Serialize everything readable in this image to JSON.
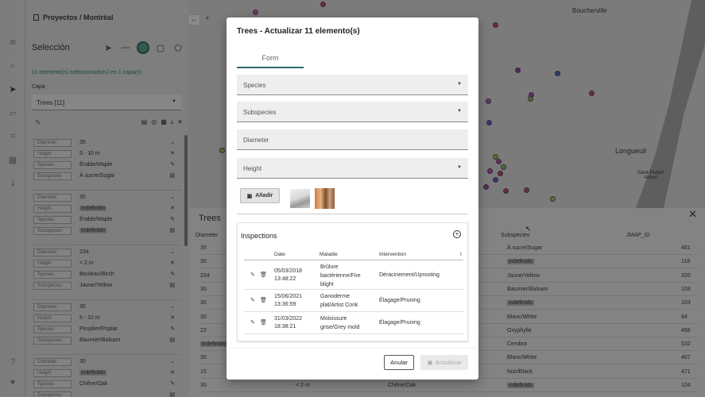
{
  "colors": {
    "accent": "#2c6b63",
    "highlight": "#315a55",
    "chip": "#686868"
  },
  "header": {
    "project": "Proyectos / Montréal"
  },
  "leftbar": {
    "icons": [
      "layers-icon",
      "search-icon",
      "cursor-icon",
      "ruler-icon",
      "crop-icon",
      "map-icon",
      "download-icon",
      "help-icon",
      "user-icon"
    ]
  },
  "selection": {
    "title": "Selección",
    "count_text": "11 elemento(s) seleccionado(s) en 1 capa(s)",
    "capa_label": "Capa",
    "capa_value": "Trees [11]",
    "records": [
      {
        "rows": [
          {
            "k": "Diameter",
            "v": "35",
            "chip": false
          },
          {
            "k": "Height",
            "v": "5 - 10 m",
            "chip": false
          },
          {
            "k": "Species",
            "v": "Érable/Maple",
            "chip": false
          },
          {
            "k": "Subspecies",
            "v": "À sucre/Sugar",
            "chip": false
          }
        ]
      },
      {
        "rows": [
          {
            "k": "Diameter",
            "v": "30",
            "chip": false
          },
          {
            "k": "Height",
            "v": "indefinido",
            "chip": true
          },
          {
            "k": "Species",
            "v": "Érable/Maple",
            "chip": false
          },
          {
            "k": "Subspecies",
            "v": "indefinido",
            "chip": true
          }
        ]
      },
      {
        "rows": [
          {
            "k": "Diameter",
            "v": "234",
            "chip": false
          },
          {
            "k": "Height",
            "v": "< 2 m",
            "chip": false
          },
          {
            "k": "Species",
            "v": "Bouleau/Birch",
            "chip": false
          },
          {
            "k": "Subspecies",
            "v": "Jaune/Yellow",
            "chip": false
          }
        ]
      },
      {
        "rows": [
          {
            "k": "Diameter",
            "v": "30",
            "chip": false
          },
          {
            "k": "Height",
            "v": "5 - 10 m",
            "chip": false
          },
          {
            "k": "Species",
            "v": "Peuplier/Poplar",
            "chip": false
          },
          {
            "k": "Subspecies",
            "v": "Baumier/Balsam",
            "chip": false
          }
        ]
      },
      {
        "rows": [
          {
            "k": "Diameter",
            "v": "30",
            "chip": false
          },
          {
            "k": "Height",
            "v": "indefinido",
            "chip": true
          },
          {
            "k": "Species",
            "v": "Chêne/Oak",
            "chip": false
          },
          {
            "k": "Subspecies",
            "v": "",
            "chip": false
          }
        ]
      }
    ]
  },
  "map": {
    "labels": {
      "boucherville": "Boucherville",
      "longueuil": "Longueuil",
      "airport": "Saint-Hubert\nAirport"
    }
  },
  "table": {
    "title": "Trees",
    "headers": {
      "diameter": "Diameter",
      "subspecies": "Subspecies",
      "jmap": "JMAP_ID"
    },
    "rows": [
      {
        "d": "35",
        "dchip": false,
        "mid": "",
        "s": "À sucre/Sugar",
        "schip": false,
        "id": "461"
      },
      {
        "d": "30",
        "dchip": false,
        "mid": "",
        "s": "indefinido",
        "schip": true,
        "id": "118"
      },
      {
        "d": "234",
        "dchip": false,
        "mid": "",
        "s": "Jaune/Yellow",
        "schip": false,
        "id": "320"
      },
      {
        "d": "30",
        "dchip": false,
        "mid": "",
        "s": "Baumier/Balsam",
        "schip": false,
        "id": "109"
      },
      {
        "d": "30",
        "dchip": false,
        "mid": "",
        "s": "indefinido",
        "schip": true,
        "id": "103"
      },
      {
        "d": "30",
        "dchip": false,
        "mid": "",
        "s": "Blanc/White",
        "schip": false,
        "id": "84"
      },
      {
        "d": "22",
        "dchip": false,
        "mid": "",
        "s": "Oxyphylle",
        "schip": false,
        "id": "468"
      },
      {
        "d": "indefinido",
        "dchip": true,
        "mid": "",
        "s": "Cembra",
        "schip": false,
        "id": "532"
      },
      {
        "d": "30",
        "dchip": false,
        "mid": "",
        "s": "Blanc/White",
        "schip": false,
        "id": "467"
      },
      {
        "d": "15",
        "dchip": false,
        "mid": "",
        "s": "Noir/Black",
        "schip": false,
        "id": "471"
      },
      {
        "d": "30",
        "dchip": false,
        "mid": "< 2 m",
        "mid2": "Chêne/Oak",
        "s": "indefinido",
        "schip": true,
        "id": "104"
      }
    ]
  },
  "modal": {
    "title": "Trees - Actualizar 11 elemento(s)",
    "tab": "Form",
    "fields": {
      "species": "Species",
      "subspecies": "Subspecies",
      "diameter": "Diameter",
      "height": "Height"
    },
    "add_label": "Añadir",
    "inspections": {
      "title": "Inspections",
      "headers": {
        "date": "Date",
        "maladie": "Maladie",
        "intervention": "Intervention",
        "extra": "I"
      },
      "rows": [
        {
          "date": "05/03/2018\n13:48:22",
          "maladie": "Brûlure\nbactérienne/Fire\nblight",
          "intervention": "Déracinement/Uprooting"
        },
        {
          "date": "15/06/2021\n13:36:59",
          "maladie": "Ganoderme\nplat/Artist Conk",
          "intervention": "Élagage/Pruning"
        },
        {
          "date": "31/03/2022\n18:38:21",
          "maladie": "Moisissure\ngrise/Grey mold",
          "intervention": "Élagage/Pruning"
        }
      ]
    },
    "cancel": "Anular",
    "update": "Actualizar"
  }
}
